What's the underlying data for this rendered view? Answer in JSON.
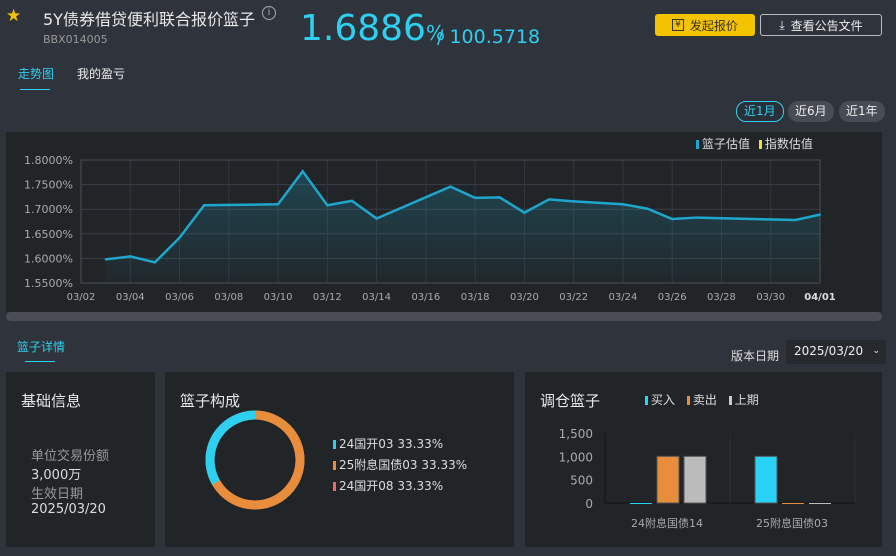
{
  "header": {
    "title": "5Y债券借贷便利联合报价篮子",
    "code": "BBX014005",
    "rate": "1.6886",
    "rate_unit": "%",
    "price": "/ 100.5718",
    "quote_btn": "发起报价",
    "doc_btn": "查看公告文件"
  },
  "tabs": [
    "走势图",
    "我的盈亏"
  ],
  "ranges": [
    "近1月",
    "近6月",
    "近1年"
  ],
  "detail_tab": "篮子详情",
  "version_label": "版本日期",
  "version_date": "2025/03/20",
  "basic": {
    "title": "基础信息",
    "unit_label": "单位交易份额",
    "unit_value": "3,000万",
    "eff_label": "生效日期",
    "eff_value": "2025/03/20"
  },
  "composition": {
    "title": "篮子构成",
    "items": [
      {
        "label": "24国开03 33.33%",
        "color": "#2dd0f0",
        "pct": 33.33
      },
      {
        "label": "25附息国债03 33.33%",
        "color": "#e88d3c",
        "pct": 33.33
      },
      {
        "label": "24国开08 33.33%",
        "color": "#e86a6a",
        "pct": 33.34
      }
    ]
  },
  "colors": {
    "accent": "#2dd0f0",
    "line": "#1ea6cc"
  },
  "chart_data": [
    {
      "type": "line",
      "legend": [
        "篮子估值",
        "指数估值"
      ],
      "ylim": [
        1.55,
        1.8
      ],
      "yticks": [
        "1.5500%",
        "1.6000%",
        "1.6500%",
        "1.7000%",
        "1.7500%",
        "1.8000%"
      ],
      "xticks": [
        "03/02",
        "03/04",
        "03/06",
        "03/08",
        "03/10",
        "03/12",
        "03/14",
        "03/16",
        "03/18",
        "03/20",
        "03/22",
        "03/24",
        "03/26",
        "03/28",
        "03/30",
        "04/01"
      ],
      "x_day": [
        1,
        2,
        3,
        4,
        5,
        8,
        9,
        10,
        11,
        12,
        15,
        16,
        17,
        18,
        19,
        20,
        22,
        23,
        24,
        25,
        29,
        30
      ],
      "values": [
        1.598,
        1.604,
        1.592,
        1.642,
        1.708,
        1.71,
        1.777,
        1.708,
        1.717,
        1.681,
        1.746,
        1.723,
        1.724,
        1.693,
        1.72,
        1.716,
        1.71,
        1.701,
        1.68,
        1.683,
        1.678,
        1.689
      ]
    },
    {
      "type": "bar",
      "title": "调仓篮子",
      "legend": [
        "买入",
        "卖出",
        "上期"
      ],
      "categories": [
        "24附息国债14",
        "25附息国债03"
      ],
      "yticks": [
        "0",
        "500",
        "1,000",
        "1,500"
      ],
      "ylim": [
        0,
        1500
      ],
      "series": [
        {
          "name": "买入",
          "values": [
            0,
            1000
          ],
          "color": "#29d3f7"
        },
        {
          "name": "卖出",
          "values": [
            1000,
            0
          ],
          "color": "#e88d3c"
        },
        {
          "name": "上期",
          "values": [
            1000,
            0
          ],
          "color": "#bbbbbb"
        }
      ]
    }
  ]
}
